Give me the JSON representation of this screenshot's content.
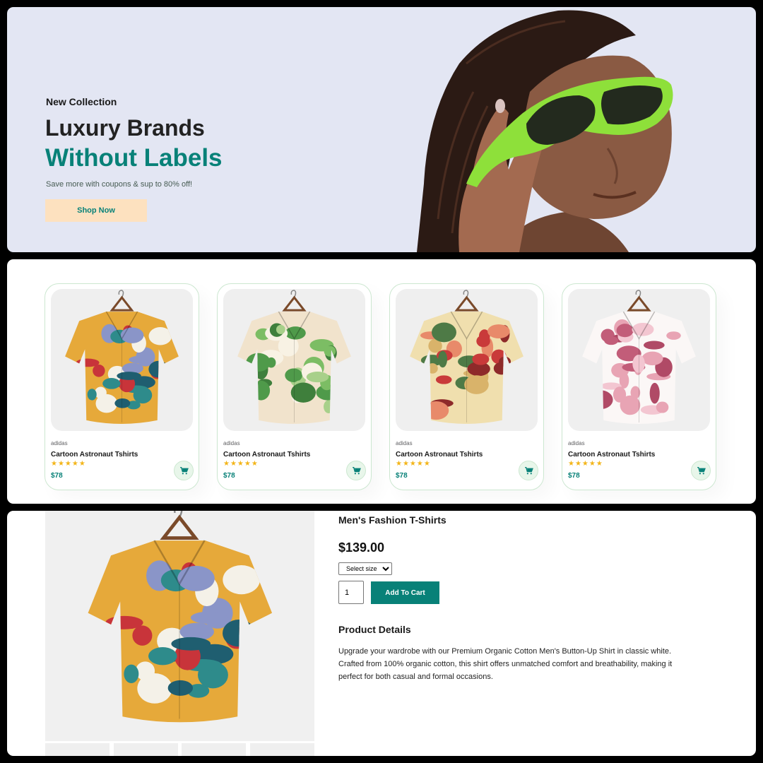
{
  "hero": {
    "subtitle": "New Collection",
    "title_line1": "Luxury Brands",
    "title_line2": "Without Labels",
    "description": "Save more with coupons & sup to 80% off!",
    "button_label": "Shop Now"
  },
  "products": [
    {
      "brand": "adidas",
      "name": "Cartoon Astronaut Tshirts",
      "stars": "★★★★★",
      "rating": 5,
      "price": "$78",
      "pattern": "cartoon"
    },
    {
      "brand": "adidas",
      "name": "Cartoon Astronaut Tshirts",
      "stars": "★★★★★",
      "rating": 5,
      "price": "$78",
      "pattern": "leaf"
    },
    {
      "brand": "adidas",
      "name": "Cartoon Astronaut Tshirts",
      "stars": "★★★★★",
      "rating": 5,
      "price": "$78",
      "pattern": "floral"
    },
    {
      "brand": "adidas",
      "name": "Cartoon Astronaut Tshirts",
      "stars": "★★★★★",
      "rating": 5,
      "price": "$78",
      "pattern": "blossom"
    }
  ],
  "detail": {
    "title": "Men's Fashion T-Shirts",
    "price": "$139.00",
    "size_select": "Select size",
    "quantity": "1",
    "add_to_cart": "Add To Cart",
    "details_heading": "Product Details",
    "details_text": "Upgrade your wardrobe with our Premium Organic Cotton Men's Button-Up Shirt in classic white. Crafted from 100% organic cotton, this shirt offers unmatched comfort and breathability, making it perfect for both casual and formal occasions."
  },
  "icons": {
    "cart": "cart-icon",
    "hanger": "hanger-icon"
  },
  "colors": {
    "accent": "#088178",
    "button_bg": "#fde1bf",
    "hero_bg": "#e3e6f3",
    "star": "#f3b519"
  }
}
